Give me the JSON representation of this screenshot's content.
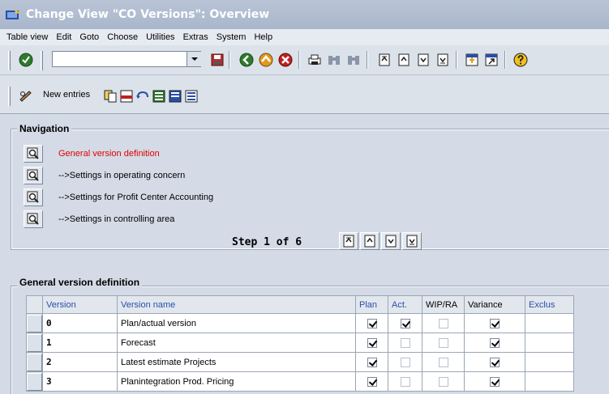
{
  "window": {
    "title": "Change View \"CO Versions\": Overview"
  },
  "menu": [
    "Table view",
    "Edit",
    "Goto",
    "Choose",
    "Utilities",
    "Extras",
    "System",
    "Help"
  ],
  "command_field": {
    "value": ""
  },
  "toolbar2": {
    "new_entries": "New entries"
  },
  "navigation": {
    "title": "Navigation",
    "items": [
      "General version definition",
      "-->Settings in operating concern",
      "-->Settings for Profit Center Accounting",
      "-->Settings in controlling area"
    ],
    "active_index": 0,
    "step_text": "Step 1 of 6"
  },
  "general": {
    "title": "General version definition",
    "columns": [
      "Version",
      "Version name",
      "Plan",
      "Act.",
      "WIP/RA",
      "Variance",
      "Exclus"
    ],
    "rows": [
      {
        "version": "0",
        "name": "Plan/actual version",
        "plan": true,
        "act": true,
        "wip": false,
        "variance": true
      },
      {
        "version": "1",
        "name": "Forecast",
        "plan": true,
        "act": false,
        "wip": false,
        "variance": true
      },
      {
        "version": "2",
        "name": "Latest estimate Projects",
        "plan": true,
        "act": false,
        "wip": false,
        "variance": true
      },
      {
        "version": "3",
        "name": "Planintegration Prod. Pricing",
        "plan": true,
        "act": false,
        "wip": false,
        "variance": true
      }
    ]
  },
  "colors": {
    "title_bar": "#a9b6cb",
    "active_link": "#e00000",
    "header_text": "#2a4ea8"
  }
}
